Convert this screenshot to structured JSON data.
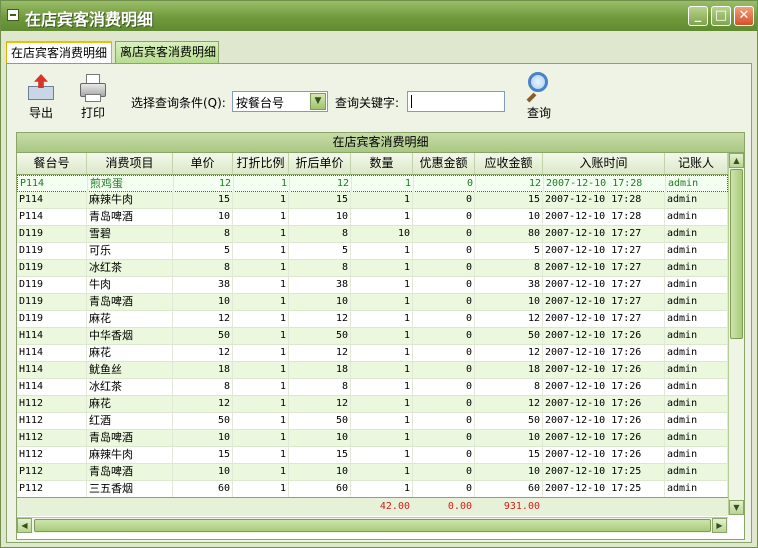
{
  "window": {
    "title": "在店宾客消费明细"
  },
  "tabs": [
    {
      "label": "在店宾客消费明细"
    },
    {
      "label": "离店宾客消费明细"
    }
  ],
  "toolbar": {
    "export_label": "导出",
    "print_label": "打印",
    "search_label": "查询"
  },
  "filter": {
    "condition_label": "选择查询条件(Q):",
    "condition_value": "按餐台号",
    "keyword_label": "查询关键字:",
    "keyword_value": ""
  },
  "grid": {
    "caption": "在店宾客消费明细",
    "columns": [
      "餐台号",
      "消费项目",
      "单价",
      "打折比例",
      "折后单价",
      "数量",
      "优惠金额",
      "应收金额",
      "入账时间",
      "记账人"
    ],
    "rows": [
      [
        "P114",
        "煎鸡蛋",
        "12",
        "1",
        "12",
        "1",
        "0",
        "12",
        "2007-12-10 17:28",
        "admin"
      ],
      [
        "P114",
        "麻辣牛肉",
        "15",
        "1",
        "15",
        "1",
        "0",
        "15",
        "2007-12-10 17:28",
        "admin"
      ],
      [
        "P114",
        "青岛啤酒",
        "10",
        "1",
        "10",
        "1",
        "0",
        "10",
        "2007-12-10 17:28",
        "admin"
      ],
      [
        "D119",
        "雪碧",
        "8",
        "1",
        "8",
        "10",
        "0",
        "80",
        "2007-12-10 17:27",
        "admin"
      ],
      [
        "D119",
        "可乐",
        "5",
        "1",
        "5",
        "1",
        "0",
        "5",
        "2007-12-10 17:27",
        "admin"
      ],
      [
        "D119",
        "冰红茶",
        "8",
        "1",
        "8",
        "1",
        "0",
        "8",
        "2007-12-10 17:27",
        "admin"
      ],
      [
        "D119",
        "牛肉",
        "38",
        "1",
        "38",
        "1",
        "0",
        "38",
        "2007-12-10 17:27",
        "admin"
      ],
      [
        "D119",
        "青岛啤酒",
        "10",
        "1",
        "10",
        "1",
        "0",
        "10",
        "2007-12-10 17:27",
        "admin"
      ],
      [
        "D119",
        "麻花",
        "12",
        "1",
        "12",
        "1",
        "0",
        "12",
        "2007-12-10 17:27",
        "admin"
      ],
      [
        "H114",
        "中华香烟",
        "50",
        "1",
        "50",
        "1",
        "0",
        "50",
        "2007-12-10 17:26",
        "admin"
      ],
      [
        "H114",
        "麻花",
        "12",
        "1",
        "12",
        "1",
        "0",
        "12",
        "2007-12-10 17:26",
        "admin"
      ],
      [
        "H114",
        "鱿鱼丝",
        "18",
        "1",
        "18",
        "1",
        "0",
        "18",
        "2007-12-10 17:26",
        "admin"
      ],
      [
        "H114",
        "冰红茶",
        "8",
        "1",
        "8",
        "1",
        "0",
        "8",
        "2007-12-10 17:26",
        "admin"
      ],
      [
        "H112",
        "麻花",
        "12",
        "1",
        "12",
        "1",
        "0",
        "12",
        "2007-12-10 17:26",
        "admin"
      ],
      [
        "H112",
        "红酒",
        "50",
        "1",
        "50",
        "1",
        "0",
        "50",
        "2007-12-10 17:26",
        "admin"
      ],
      [
        "H112",
        "青岛啤酒",
        "10",
        "1",
        "10",
        "1",
        "0",
        "10",
        "2007-12-10 17:26",
        "admin"
      ],
      [
        "H112",
        "麻辣牛肉",
        "15",
        "1",
        "15",
        "1",
        "0",
        "15",
        "2007-12-10 17:26",
        "admin"
      ],
      [
        "P112",
        "青岛啤酒",
        "10",
        "1",
        "10",
        "1",
        "0",
        "10",
        "2007-12-10 17:25",
        "admin"
      ],
      [
        "P112",
        "三五香烟",
        "60",
        "1",
        "60",
        "1",
        "0",
        "60",
        "2007-12-10 17:25",
        "admin"
      ]
    ],
    "totals": {
      "quantity": "42.00",
      "discount": "0.00",
      "receivable": "931.00"
    }
  },
  "colors": {
    "accent": "#6f9a3c",
    "total_text": "#d02020",
    "selected_text": "#1f7a1f"
  }
}
